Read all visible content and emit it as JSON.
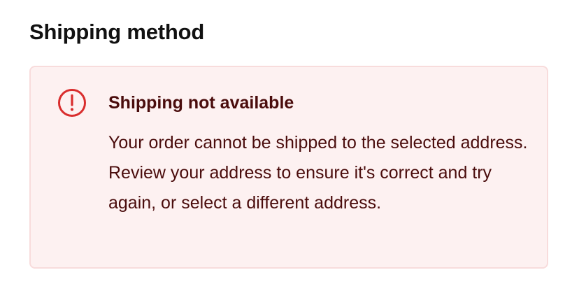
{
  "section": {
    "title": "Shipping method"
  },
  "alert": {
    "icon": "exclamation-circle-icon",
    "title": "Shipping not available",
    "message": "Your order cannot be shipped to the selected address. Review your address to ensure it's correct and try again, or select a different address."
  },
  "colors": {
    "alert_background": "#fdf1f1",
    "alert_border": "#f8dcdc",
    "alert_text": "#4a0c0c",
    "icon_red": "#d92d2d",
    "heading_text": "#111111"
  }
}
